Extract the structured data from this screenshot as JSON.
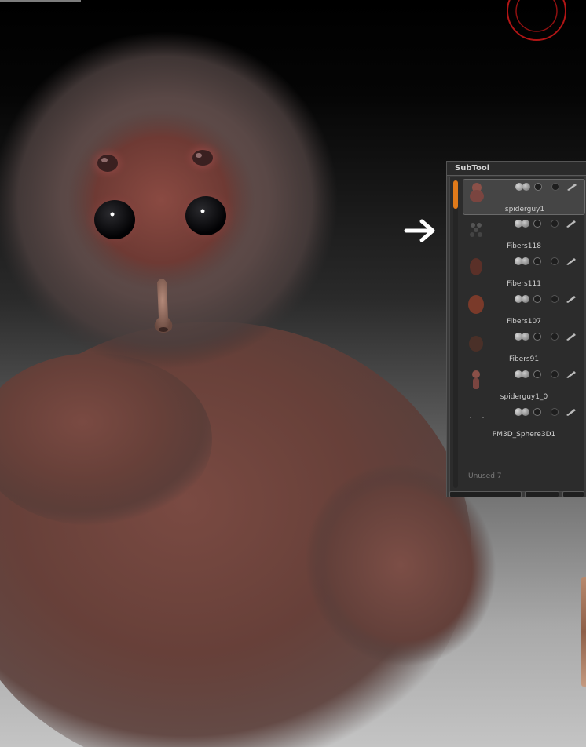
{
  "panel": {
    "title": "SubTool",
    "items": [
      {
        "name": "spiderguy1",
        "active": true
      },
      {
        "name": "Fibers118",
        "active": false
      },
      {
        "name": "Fibers111",
        "active": false
      },
      {
        "name": "Fibers107",
        "active": false
      },
      {
        "name": "Fibers91",
        "active": false
      },
      {
        "name": "spiderguy1_0",
        "active": false
      },
      {
        "name": "PM3D_Sphere3D1",
        "active": false
      }
    ],
    "unused_label": "Unused  7"
  },
  "icons": {
    "arrow": "arrow-right-icon",
    "visibility": "eye-toggle-icon",
    "edit": "pen-icon"
  },
  "colors": {
    "accent": "#e07a1a",
    "fur": "#6e4a42",
    "hud_ring": "#c01818"
  }
}
